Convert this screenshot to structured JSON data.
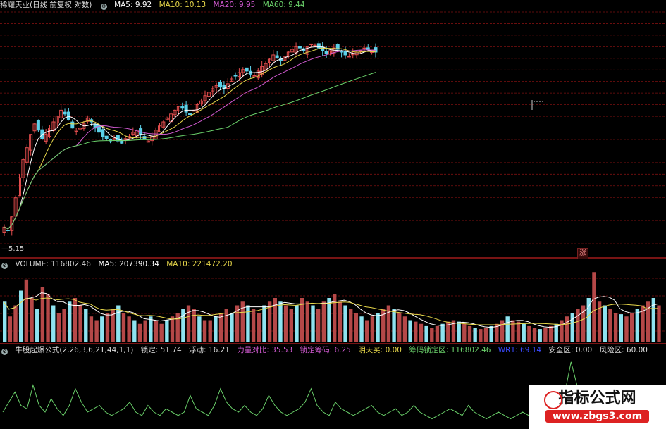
{
  "main_header": {
    "title": "稀耀天业(日线 前复权 对数)",
    "ma5_label": "MA5: 9.92",
    "ma10_label": "MA10: 10.13",
    "ma20_label": "MA20: 9.95",
    "ma60_label": "MA60: 9.44"
  },
  "volume_header": {
    "label": "VOLUME: 116802.46",
    "ma5_label": "MA5: 207390.34",
    "ma10_label": "MA10: 221472.20"
  },
  "indicator_header": {
    "name": "牛股起爆公式(2,26,3,6,21,44,1,1)",
    "lock": "锁定: 51.74",
    "float": "浮动: 16.21",
    "power": "力量对比: 35.53",
    "chips": "锁定筹码: 6.25",
    "buy": "明天买: 0.00",
    "chip_zone": "筹码锁定区: 116802.46",
    "v1": "WR1: 69.14",
    "safe": "安全区: 0.00",
    "risk": "风险区: 60.00"
  },
  "price_low_label": "5.15",
  "zhang_label": "涨",
  "watermark": {
    "title": "指标公式网",
    "url": "www.zbgs3.com"
  },
  "colors": {
    "up": "#e34d4d",
    "down": "#5bd0e8",
    "ma5": "#ffffff",
    "ma10": "#e8d84a",
    "ma20": "#d15ad1",
    "ma60": "#6ad06a",
    "grid": "#7a1010",
    "indicator": "#6ad06a"
  },
  "chart_data": [
    {
      "type": "candlestick",
      "title": "稀耀天业(日线 前复权 对数)",
      "close": [
        5.3,
        5.2,
        5.6,
        6.2,
        6.9,
        7.6,
        8.1,
        8.7,
        9.2,
        8.9,
        8.5,
        8.7,
        9.0,
        9.3,
        9.6,
        9.9,
        9.7,
        9.4,
        9.0,
        8.9,
        9.0,
        9.2,
        9.5,
        9.3,
        9.0,
        8.8,
        8.6,
        8.5,
        8.4,
        8.5,
        8.4,
        8.3,
        8.5,
        8.6,
        8.8,
        8.9,
        8.7,
        8.5,
        8.4,
        8.6,
        8.9,
        9.1,
        9.3,
        9.5,
        9.7,
        9.9,
        10.1,
        10.0,
        9.8,
        9.7,
        9.9,
        10.2,
        10.4,
        10.7,
        10.9,
        11.1,
        11.3,
        11.2,
        11.1,
        11.4,
        11.7,
        11.9,
        12.1,
        12.3,
        12.2,
        12.0,
        11.9,
        12.2,
        12.5,
        12.7,
        13.0,
        13.3,
        13.1,
        12.9,
        13.2,
        13.5,
        13.7,
        13.9,
        13.8,
        13.6,
        13.9,
        14.1,
        14.0,
        13.8,
        13.6,
        13.4,
        13.6,
        13.8,
        13.7,
        13.5,
        13.3,
        13.2,
        13.4,
        13.5,
        13.6,
        13.8,
        13.7,
        13.6,
        13.5
      ],
      "ylim": [
        5.15,
        14.5
      ]
    },
    {
      "type": "bar",
      "title": "VOLUME",
      "values": [
        0.55,
        0.35,
        0.5,
        0.7,
        0.85,
        0.6,
        0.45,
        0.75,
        0.65,
        0.5,
        0.4,
        0.45,
        0.55,
        0.6,
        0.5,
        0.45,
        0.35,
        0.3,
        0.35,
        0.4,
        0.45,
        0.5,
        0.4,
        0.35,
        0.3,
        0.25,
        0.3,
        0.35,
        0.3,
        0.25,
        0.3,
        0.35,
        0.4,
        0.45,
        0.5,
        0.45,
        0.35,
        0.3,
        0.3,
        0.35,
        0.4,
        0.45,
        0.4,
        0.5,
        0.55,
        0.5,
        0.45,
        0.4,
        0.5,
        0.55,
        0.6,
        0.55,
        0.5,
        0.45,
        0.5,
        0.6,
        0.55,
        0.5,
        0.45,
        0.55,
        0.6,
        0.65,
        0.55,
        0.5,
        0.45,
        0.4,
        0.35,
        0.3,
        0.35,
        0.4,
        0.45,
        0.5,
        0.45,
        0.4,
        0.35,
        0.3,
        0.28,
        0.25,
        0.22,
        0.2,
        0.22,
        0.25,
        0.28,
        0.3,
        0.28,
        0.25,
        0.22,
        0.2,
        0.18,
        0.2,
        0.22,
        0.25,
        0.3,
        0.35,
        0.3,
        0.28,
        0.25,
        0.22,
        0.2,
        0.18,
        0.2,
        0.22,
        0.25,
        0.3,
        0.35,
        0.4,
        0.45,
        0.5,
        0.6,
        0.95,
        0.55,
        0.5,
        0.45,
        0.4,
        0.38,
        0.35,
        0.4,
        0.45,
        0.5,
        0.55,
        0.6,
        0.5
      ]
    },
    {
      "type": "line",
      "title": "牛股起爆公式",
      "values": [
        0.2,
        0.35,
        0.5,
        0.3,
        0.25,
        0.6,
        0.3,
        0.2,
        0.4,
        0.25,
        0.15,
        0.3,
        0.55,
        0.35,
        0.2,
        0.25,
        0.3,
        0.2,
        0.15,
        0.2,
        0.25,
        0.35,
        0.2,
        0.15,
        0.3,
        0.2,
        0.15,
        0.25,
        0.2,
        0.15,
        0.2,
        0.45,
        0.25,
        0.2,
        0.15,
        0.3,
        0.55,
        0.35,
        0.25,
        0.2,
        0.3,
        0.2,
        0.15,
        0.25,
        0.45,
        0.3,
        0.2,
        0.15,
        0.2,
        0.25,
        0.35,
        0.55,
        0.3,
        0.2,
        0.15,
        0.35,
        0.25,
        0.2,
        0.15,
        0.2,
        0.25,
        0.3,
        0.2,
        0.15,
        0.2,
        0.25,
        0.15,
        0.2,
        0.3,
        0.2,
        0.15,
        0.1,
        0.15,
        0.2,
        0.25,
        0.2,
        0.15,
        0.3,
        0.2,
        0.15,
        0.1,
        0.15,
        0.2,
        0.15,
        0.1,
        0.15,
        0.2,
        0.15,
        0.1,
        0.15,
        0.2,
        0.25,
        0.3,
        0.5,
        0.95,
        0.6,
        0.4,
        0.3
      ]
    }
  ]
}
